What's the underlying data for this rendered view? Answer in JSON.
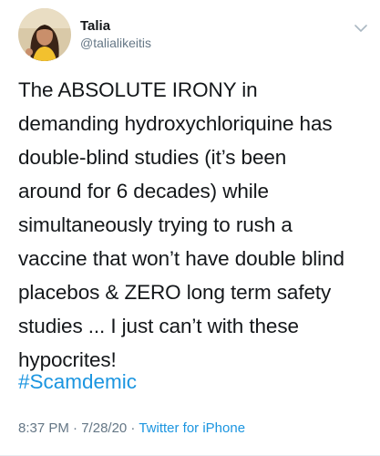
{
  "tweet": {
    "author": {
      "display_name": "Talia",
      "handle": "@talialikeitis",
      "avatar_icon": "profile-photo"
    },
    "menu_icon": "chevron-down-icon",
    "text": "The ABSOLUTE IRONY in\ndemanding hydroxychloriquine has\ndouble-blind studies (it’s been\naround for 6 decades) while\nsimultaneously trying to rush a\nvaccine that won’t have double blind\nplacebos & ZERO long term safety\nstudies ... I just can’t with these\nhypocrites!",
    "hashtag": "#Scamdemic",
    "time": "8:37 PM",
    "separator_1": " · ",
    "date": "7/28/20",
    "separator_2": " · ",
    "source": "Twitter for iPhone"
  },
  "colors": {
    "link": "#1b95e0",
    "secondary_text": "#657786",
    "primary_text": "#14171a"
  }
}
